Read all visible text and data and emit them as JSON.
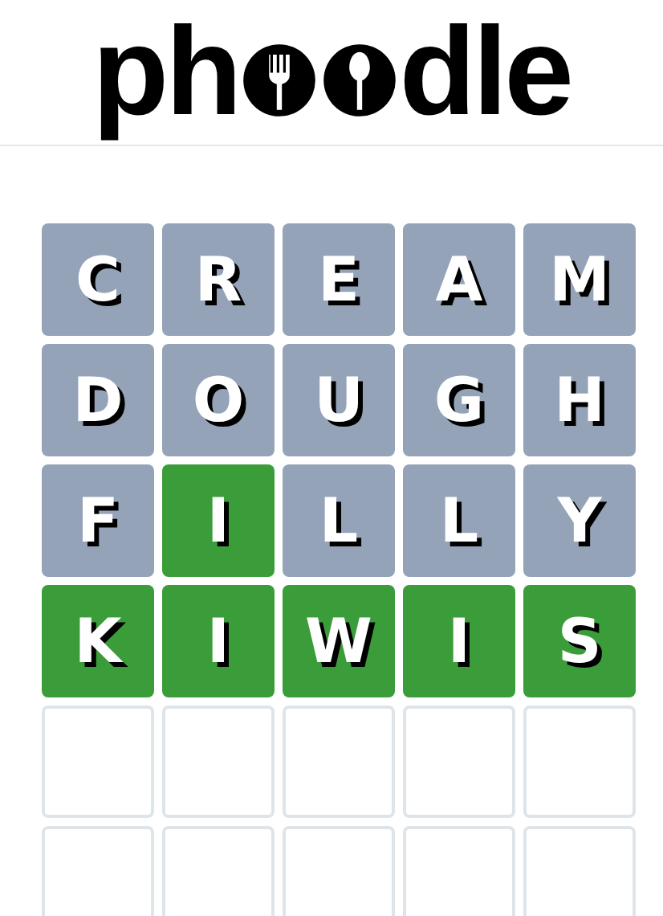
{
  "logo": {
    "left": "ph",
    "right": "dle"
  },
  "board": [
    {
      "tiles": [
        {
          "letter": "C",
          "kind": "absent"
        },
        {
          "letter": "R",
          "kind": "absent"
        },
        {
          "letter": "E",
          "kind": "absent"
        },
        {
          "letter": "A",
          "kind": "absent"
        },
        {
          "letter": "M",
          "kind": "absent"
        }
      ]
    },
    {
      "tiles": [
        {
          "letter": "D",
          "kind": "absent"
        },
        {
          "letter": "O",
          "kind": "absent"
        },
        {
          "letter": "U",
          "kind": "absent"
        },
        {
          "letter": "G",
          "kind": "absent"
        },
        {
          "letter": "H",
          "kind": "absent"
        }
      ]
    },
    {
      "tiles": [
        {
          "letter": "F",
          "kind": "absent"
        },
        {
          "letter": "I",
          "kind": "correct"
        },
        {
          "letter": "L",
          "kind": "absent"
        },
        {
          "letter": "L",
          "kind": "absent"
        },
        {
          "letter": "Y",
          "kind": "absent"
        }
      ]
    },
    {
      "tiles": [
        {
          "letter": "K",
          "kind": "correct"
        },
        {
          "letter": "I",
          "kind": "correct"
        },
        {
          "letter": "W",
          "kind": "correct"
        },
        {
          "letter": "I",
          "kind": "correct"
        },
        {
          "letter": "S",
          "kind": "correct"
        }
      ]
    },
    {
      "tiles": [
        {
          "kind": "empty"
        },
        {
          "kind": "empty"
        },
        {
          "kind": "empty"
        },
        {
          "kind": "empty"
        },
        {
          "kind": "empty"
        }
      ]
    },
    {
      "tiles": [
        {
          "kind": "empty"
        },
        {
          "kind": "empty"
        },
        {
          "kind": "empty"
        },
        {
          "kind": "empty"
        },
        {
          "kind": "empty"
        }
      ]
    }
  ]
}
